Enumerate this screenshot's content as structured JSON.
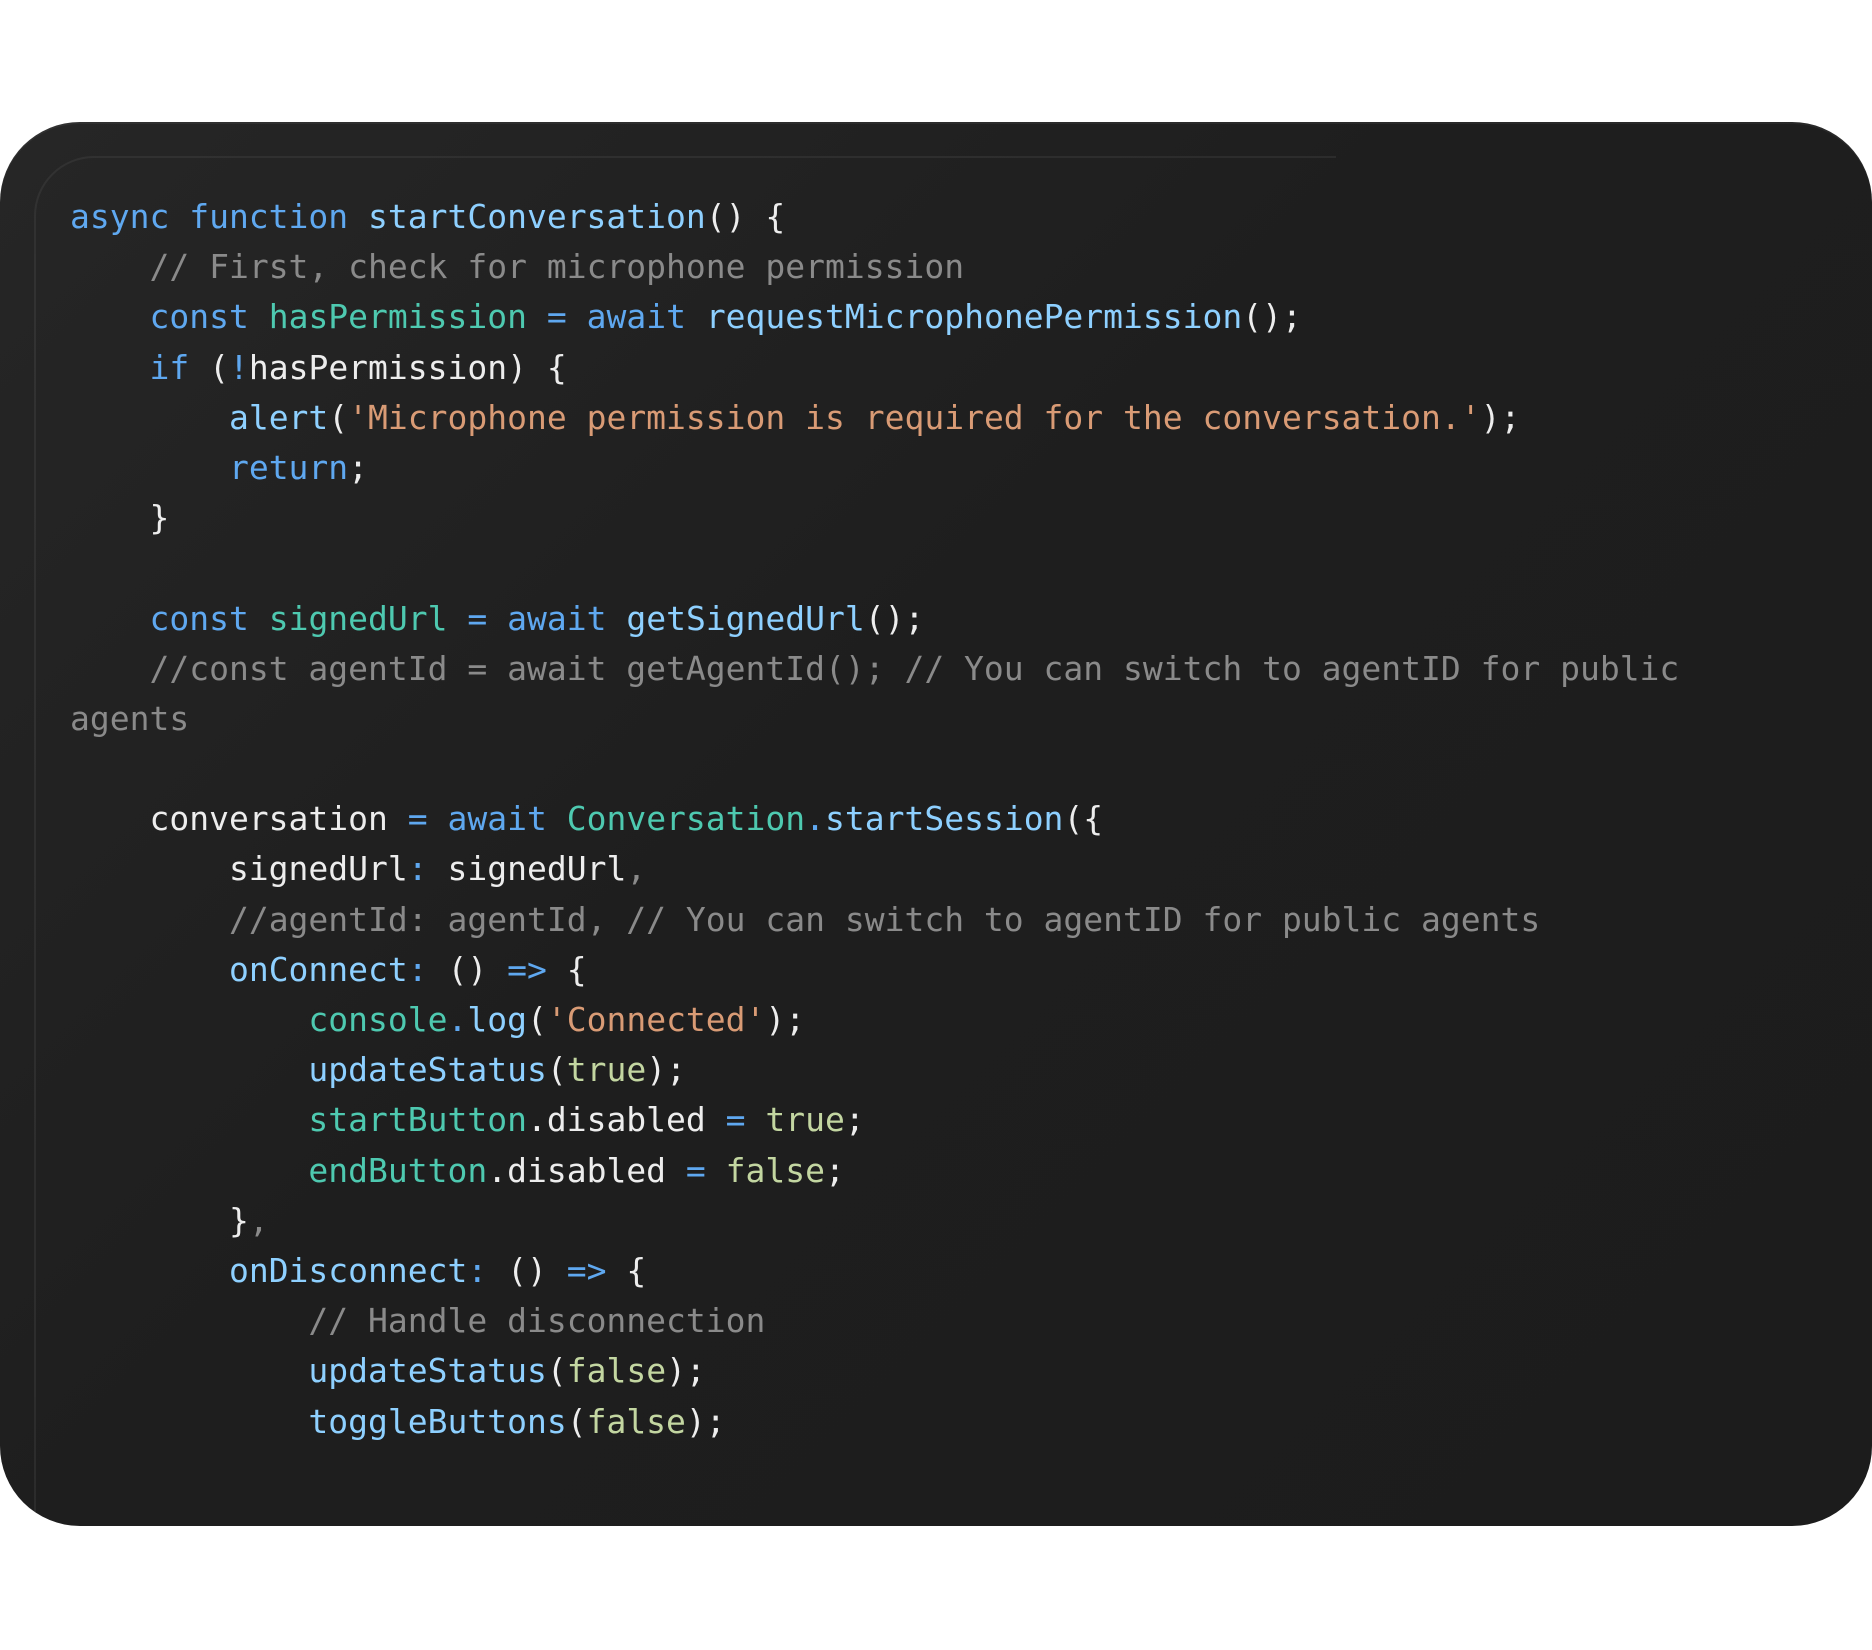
{
  "code_lines": [
    [
      {
        "t": "kw",
        "s": "async function "
      },
      {
        "t": "fn",
        "s": "startConversation"
      },
      {
        "t": "plain",
        "s": "() {"
      }
    ],
    [
      {
        "t": "plain",
        "s": "    "
      },
      {
        "t": "cm",
        "s": "// First, check for microphone permission"
      }
    ],
    [
      {
        "t": "plain",
        "s": "    "
      },
      {
        "t": "kw",
        "s": "const "
      },
      {
        "t": "var",
        "s": "hasPermission"
      },
      {
        "t": "op",
        "s": " = "
      },
      {
        "t": "kw",
        "s": "await "
      },
      {
        "t": "fn",
        "s": "requestMicrophonePermission"
      },
      {
        "t": "plain",
        "s": "();"
      }
    ],
    [
      {
        "t": "plain",
        "s": "    "
      },
      {
        "t": "kw",
        "s": "if "
      },
      {
        "t": "plain",
        "s": "("
      },
      {
        "t": "op",
        "s": "!"
      },
      {
        "t": "plain",
        "s": "hasPermission) {"
      }
    ],
    [
      {
        "t": "plain",
        "s": "        "
      },
      {
        "t": "fn",
        "s": "alert"
      },
      {
        "t": "plain",
        "s": "("
      },
      {
        "t": "str",
        "s": "'Microphone permission is required for the conversation.'"
      },
      {
        "t": "plain",
        "s": ");"
      }
    ],
    [
      {
        "t": "plain",
        "s": "        "
      },
      {
        "t": "kw",
        "s": "return"
      },
      {
        "t": "plain",
        "s": ";"
      }
    ],
    [
      {
        "t": "plain",
        "s": "    }"
      }
    ],
    [
      {
        "t": "plain",
        "s": ""
      }
    ],
    [
      {
        "t": "plain",
        "s": "    "
      },
      {
        "t": "kw",
        "s": "const "
      },
      {
        "t": "var",
        "s": "signedUrl"
      },
      {
        "t": "op",
        "s": " = "
      },
      {
        "t": "kw",
        "s": "await "
      },
      {
        "t": "fn",
        "s": "getSignedUrl"
      },
      {
        "t": "plain",
        "s": "();"
      }
    ],
    [
      {
        "t": "plain",
        "s": "    "
      },
      {
        "t": "cm",
        "s": "//const agentId = await getAgentId(); // You can switch to agentID for public"
      }
    ],
    [
      {
        "t": "cm",
        "s": "agents"
      }
    ],
    [
      {
        "t": "plain",
        "s": ""
      }
    ],
    [
      {
        "t": "plain",
        "s": "    conversation"
      },
      {
        "t": "op",
        "s": " = "
      },
      {
        "t": "kw",
        "s": "await "
      },
      {
        "t": "var",
        "s": "Conversation"
      },
      {
        "t": "op",
        "s": "."
      },
      {
        "t": "fn",
        "s": "startSession"
      },
      {
        "t": "plain",
        "s": "({"
      }
    ],
    [
      {
        "t": "plain",
        "s": "        signedUrl"
      },
      {
        "t": "op",
        "s": ": "
      },
      {
        "t": "plain",
        "s": "signedUrl"
      },
      {
        "t": "cm",
        "s": ","
      }
    ],
    [
      {
        "t": "plain",
        "s": "        "
      },
      {
        "t": "cm",
        "s": "//agentId: agentId, // You can switch to agentID for public agents"
      }
    ],
    [
      {
        "t": "plain",
        "s": "        "
      },
      {
        "t": "fn",
        "s": "onConnect"
      },
      {
        "t": "op",
        "s": ": "
      },
      {
        "t": "plain",
        "s": "() "
      },
      {
        "t": "op",
        "s": "=>"
      },
      {
        "t": "plain",
        "s": " {"
      }
    ],
    [
      {
        "t": "plain",
        "s": "            "
      },
      {
        "t": "var",
        "s": "console"
      },
      {
        "t": "op",
        "s": "."
      },
      {
        "t": "fn",
        "s": "log"
      },
      {
        "t": "plain",
        "s": "("
      },
      {
        "t": "str",
        "s": "'Connected'"
      },
      {
        "t": "plain",
        "s": ");"
      }
    ],
    [
      {
        "t": "plain",
        "s": "            "
      },
      {
        "t": "fn",
        "s": "updateStatus"
      },
      {
        "t": "plain",
        "s": "("
      },
      {
        "t": "bool",
        "s": "true"
      },
      {
        "t": "plain",
        "s": ");"
      }
    ],
    [
      {
        "t": "plain",
        "s": "            "
      },
      {
        "t": "var",
        "s": "startButton"
      },
      {
        "t": "plain",
        "s": ".disabled"
      },
      {
        "t": "op",
        "s": " = "
      },
      {
        "t": "bool",
        "s": "true"
      },
      {
        "t": "plain",
        "s": ";"
      }
    ],
    [
      {
        "t": "plain",
        "s": "            "
      },
      {
        "t": "var",
        "s": "endButton"
      },
      {
        "t": "plain",
        "s": ".disabled"
      },
      {
        "t": "op",
        "s": " = "
      },
      {
        "t": "bool",
        "s": "false"
      },
      {
        "t": "plain",
        "s": ";"
      }
    ],
    [
      {
        "t": "plain",
        "s": "        }"
      },
      {
        "t": "cm",
        "s": ","
      }
    ],
    [
      {
        "t": "plain",
        "s": "        "
      },
      {
        "t": "fn",
        "s": "onDisconnect"
      },
      {
        "t": "op",
        "s": ": "
      },
      {
        "t": "plain",
        "s": "() "
      },
      {
        "t": "op",
        "s": "=>"
      },
      {
        "t": "plain",
        "s": " {"
      }
    ],
    [
      {
        "t": "plain",
        "s": "            "
      },
      {
        "t": "cm",
        "s": "// Handle disconnection"
      }
    ],
    [
      {
        "t": "plain",
        "s": "            "
      },
      {
        "t": "fn",
        "s": "updateStatus"
      },
      {
        "t": "plain",
        "s": "("
      },
      {
        "t": "bool",
        "s": "false"
      },
      {
        "t": "plain",
        "s": ");"
      }
    ],
    [
      {
        "t": "plain",
        "s": "            "
      },
      {
        "t": "fn",
        "s": "toggleButtons"
      },
      {
        "t": "plain",
        "s": "("
      },
      {
        "t": "bool",
        "s": "false"
      },
      {
        "t": "plain",
        "s": ");"
      }
    ]
  ],
  "colors": {
    "background": "#1e1e1e",
    "keyword": "#5fa8f0",
    "function": "#8ed0ff",
    "variable": "#4ec9b0",
    "string": "#d99b75",
    "comment": "#8a8a8a",
    "boolean": "#c3d6a1"
  }
}
